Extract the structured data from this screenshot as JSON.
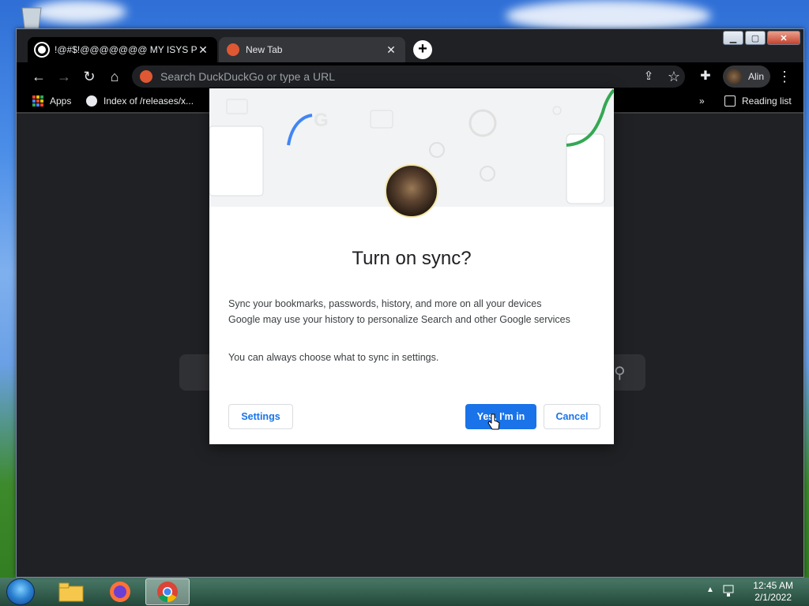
{
  "tabs": [
    {
      "title": "!@#$!@@@@@@@ MY ISYS PF",
      "close": "✕"
    },
    {
      "title": "New Tab",
      "close": "✕"
    }
  ],
  "omnibox": {
    "placeholder": "Search DuckDuckGo or type a URL"
  },
  "profile": {
    "name": "Alin"
  },
  "bookmarks": {
    "apps": "Apps",
    "item1": "Index of /releases/x...",
    "overflow": "»",
    "reading_list": "Reading list"
  },
  "dialog": {
    "title": "Turn on sync?",
    "line1": "Sync your bookmarks, passwords, history, and more on all your devices",
    "line2": "Google may use your history to personalize Search and other Google services",
    "line3": "You can always choose what to sync in settings.",
    "settings_label": "Settings",
    "confirm_label": "Yes, I'm in",
    "cancel_label": "Cancel"
  },
  "taskbar": {
    "time": "12:45 AM",
    "date": "2/1/2022"
  },
  "colors": {
    "accent": "#1a73e8",
    "sync_green": "#34a853"
  }
}
